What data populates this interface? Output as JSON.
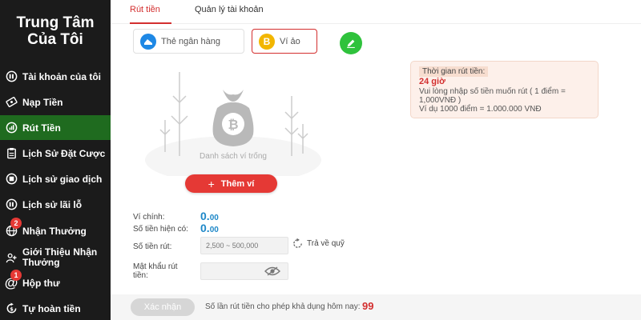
{
  "sidebar": {
    "title_line1": "Trung Tâm",
    "title_line2": "Của Tôi",
    "items": [
      {
        "label": "Tài khoản của tôi",
        "icon": "account-icon"
      },
      {
        "label": "Nạp Tiền",
        "icon": "deposit-icon"
      },
      {
        "label": "Rút Tiền",
        "icon": "withdraw-chart-icon",
        "active": true
      },
      {
        "label": "Lịch Sử Đặt Cược",
        "icon": "clipboard-icon"
      },
      {
        "label": "Lịch sử giao dịch",
        "icon": "transaction-icon"
      },
      {
        "label": "Lịch sử lãi lỗ",
        "icon": "profit-loss-icon"
      },
      {
        "label": "Nhận Thưởng",
        "icon": "globe-icon",
        "badge": "2"
      },
      {
        "label": "Giới Thiệu Nhận Thưởng",
        "icon": "referral-icon"
      },
      {
        "label": "Hộp thư",
        "icon": "mail-at-icon",
        "badge": "1"
      },
      {
        "label": "Tự hoàn tiền",
        "icon": "refund-icon"
      }
    ]
  },
  "tabs": [
    {
      "label": "Rút tiền",
      "active": true
    },
    {
      "label": "Quản lý tài khoản",
      "active": false
    }
  ],
  "methods": {
    "bank": "Thẻ ngân hàng",
    "wallet": "Ví ảo"
  },
  "info": {
    "title": "Thời gian rút tiền:",
    "hours": "24 giờ",
    "line1": "Vui lòng nhập số tiền muốn rút ( 1 điểm =",
    "line2": "1,000VNĐ )",
    "line3": "Ví dụ 1000 điểm = 1.000.000 VNĐ"
  },
  "empty": {
    "text": "Danh sách ví trống"
  },
  "add_wallet": "Thêm ví",
  "form": {
    "main_wallet_label": "Ví chính:",
    "main_wallet_int": "0.",
    "main_wallet_dec": "00",
    "available_label": "Số tiền hiện có:",
    "available_int": "0.",
    "available_dec": "00",
    "amount_label": "Số tiền rút:",
    "amount_placeholder": "2,500 ~ 500,000",
    "return_label": "Trả về quỹ",
    "password_label_line1": "Mật khẩu rút",
    "password_label_line2": "tiền:"
  },
  "footer": {
    "confirm": "Xác nhận",
    "text": "Số lần rút tiền cho phép khả dụng hôm nay:",
    "count": "99"
  },
  "colors": {
    "accent": "#d32f2f",
    "sidebar_bg": "#1b1b1b",
    "active_green": "#1f6b1f",
    "amount_blue": "#1e88c8"
  }
}
